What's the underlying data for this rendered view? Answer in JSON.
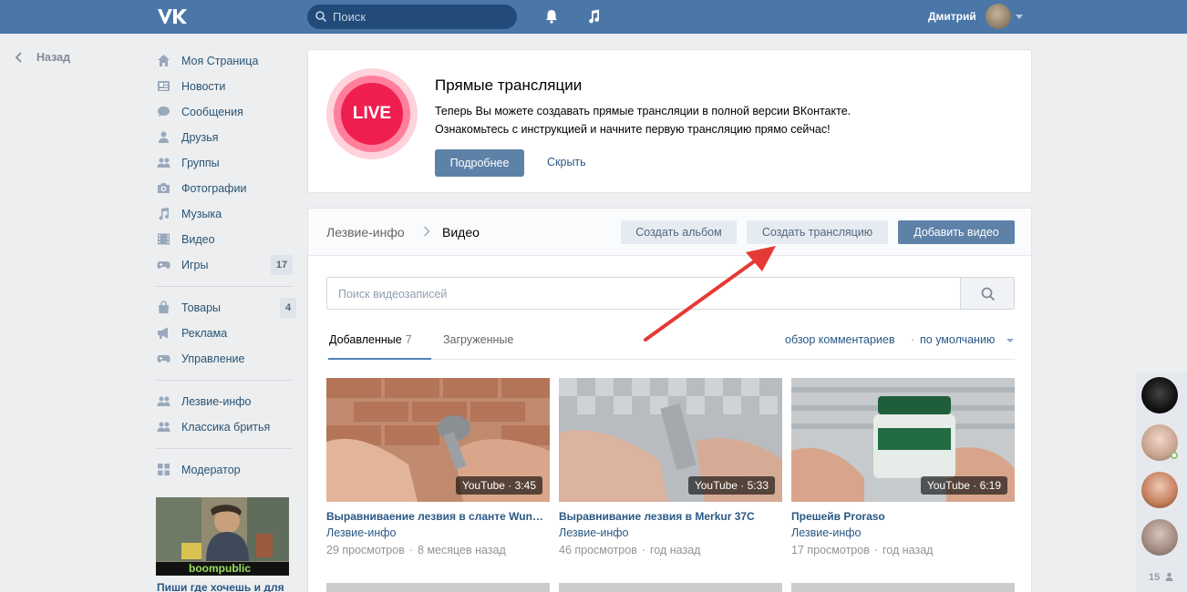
{
  "topbar": {
    "logo": "VK",
    "search_placeholder": "Поиск",
    "user_name": "Дмитрий"
  },
  "back_label": "Назад",
  "menu": {
    "items": [
      {
        "label": "Моя Страница",
        "icon": "home-icon"
      },
      {
        "label": "Новости",
        "icon": "news-icon"
      },
      {
        "label": "Сообщения",
        "icon": "messages-icon"
      },
      {
        "label": "Друзья",
        "icon": "friends-icon"
      },
      {
        "label": "Группы",
        "icon": "groups-icon"
      },
      {
        "label": "Фотографии",
        "icon": "camera-icon"
      },
      {
        "label": "Музыка",
        "icon": "music-icon"
      },
      {
        "label": "Видео",
        "icon": "video-icon"
      },
      {
        "label": "Игры",
        "icon": "gamepad-icon",
        "count": "17"
      }
    ],
    "items2": [
      {
        "label": "Товары",
        "icon": "bag-icon",
        "count": "4"
      },
      {
        "label": "Реклама",
        "icon": "megaphone-icon"
      },
      {
        "label": "Управление",
        "icon": "gamepad-icon"
      }
    ],
    "items3": [
      {
        "label": "Лезвие-инфо",
        "icon": "group-icon"
      },
      {
        "label": "Классика бритья",
        "icon": "group-icon"
      }
    ],
    "items4": [
      {
        "label": "Модератор",
        "icon": "grid-icon"
      }
    ],
    "promo_brand": "boompublic",
    "promo_text": "Пиши где хочешь и для"
  },
  "live": {
    "badge": "LIVE",
    "title": "Прямые трансляции",
    "desc_line1": "Теперь Вы можете создавать прямые трансляции в полной версии ВКонтакте.",
    "desc_line2": "Ознакомьтесь с инструкцией и начните первую трансляцию прямо сейчас!",
    "more_button": "Подробнее",
    "hide_button": "Скрыть"
  },
  "videos": {
    "crumb_group": "Лезвие-инфо",
    "crumb_page": "Видео",
    "create_album": "Создать альбом",
    "create_stream": "Создать трансляцию",
    "add_video": "Добавить видео",
    "search_placeholder": "Поиск видеозаписей",
    "tab_added": "Добавленные",
    "tab_added_count": "7",
    "tab_uploaded": "Загруженные",
    "filter_comments": "обзор комментариев",
    "filter_sep": "·",
    "filter_sort": "по умолчанию",
    "cards": [
      {
        "badge": "YouTube · 3:45",
        "title": "Выравниваение лезвия в сланте Wunderbar",
        "owner": "Лезвие-инфо",
        "views": "29 просмотров",
        "sep": "·",
        "age": "8 месяцев назад"
      },
      {
        "badge": "YouTube · 5:33",
        "title": "Выравнивание лезвия в Merkur 37C",
        "owner": "Лезвие-инфо",
        "views": "46 просмотров",
        "sep": "·",
        "age": "год назад"
      },
      {
        "badge": "YouTube · 6:19",
        "title": "Прешейв Proraso",
        "owner": "Лезвие-инфо",
        "views": "17 просмотров",
        "sep": "·",
        "age": "год назад"
      }
    ]
  },
  "friends_bar": {
    "count": "15"
  },
  "colors": {
    "header": "#4a76a8",
    "link": "#2a5885",
    "accent_button": "#5e81a8",
    "live_red": "#ee1e4f",
    "annotation_arrow": "#e53935"
  }
}
